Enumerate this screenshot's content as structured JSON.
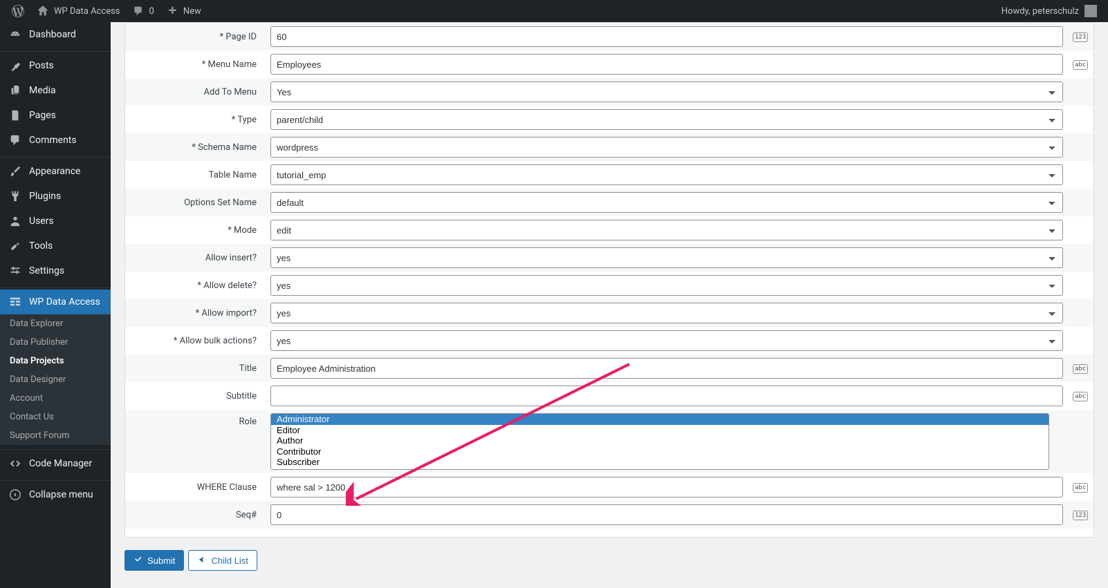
{
  "adminBar": {
    "siteName": "WP Data Access",
    "commentCount": "0",
    "newLabel": "New",
    "howdy": "Howdy, peterschulz"
  },
  "sidebar": {
    "items": [
      {
        "label": "Dashboard"
      },
      {
        "label": "Posts"
      },
      {
        "label": "Media"
      },
      {
        "label": "Pages"
      },
      {
        "label": "Comments"
      },
      {
        "label": "Appearance"
      },
      {
        "label": "Plugins"
      },
      {
        "label": "Users"
      },
      {
        "label": "Tools"
      },
      {
        "label": "Settings"
      },
      {
        "label": "WP Data Access"
      },
      {
        "label": "Code Manager"
      },
      {
        "label": "Collapse menu"
      }
    ],
    "submenu": [
      {
        "label": "Data Explorer"
      },
      {
        "label": "Data Publisher"
      },
      {
        "label": "Data Projects"
      },
      {
        "label": "Data Designer"
      },
      {
        "label": "Account"
      },
      {
        "label": "Contact Us"
      },
      {
        "label": "Support Forum"
      }
    ]
  },
  "form": {
    "pageId": {
      "label": "* Page ID",
      "value": "60",
      "hint": "123"
    },
    "menuName": {
      "label": "* Menu Name",
      "value": "Employees",
      "hint": "abc"
    },
    "addToMenu": {
      "label": "Add To Menu",
      "value": "Yes"
    },
    "type": {
      "label": "* Type",
      "value": "parent/child"
    },
    "schemaName": {
      "label": "* Schema Name",
      "value": "wordpress"
    },
    "tableName": {
      "label": "Table Name",
      "value": "tutorial_emp"
    },
    "optionsSetName": {
      "label": "Options Set Name",
      "value": "default"
    },
    "mode": {
      "label": "* Mode",
      "value": "edit"
    },
    "allowInsert": {
      "label": "Allow insert?",
      "value": "yes"
    },
    "allowDelete": {
      "label": "* Allow delete?",
      "value": "yes"
    },
    "allowImport": {
      "label": "* Allow import?",
      "value": "yes"
    },
    "allowBulk": {
      "label": "* Allow bulk actions?",
      "value": "yes"
    },
    "title": {
      "label": "Title",
      "value": "Employee Administration",
      "hint": "abc"
    },
    "subtitle": {
      "label": "Subtitle",
      "value": "",
      "hint": "abc"
    },
    "role": {
      "label": "Role",
      "options": [
        "Administrator",
        "Editor",
        "Author",
        "Contributor",
        "Subscriber"
      ],
      "selected": "Administrator"
    },
    "whereClause": {
      "label": "WHERE Clause",
      "value": "where sal > 1200",
      "hint": "abc"
    },
    "seq": {
      "label": "Seq#",
      "value": "0",
      "hint": "123"
    }
  },
  "buttons": {
    "submit": "Submit",
    "childList": "Child List"
  }
}
